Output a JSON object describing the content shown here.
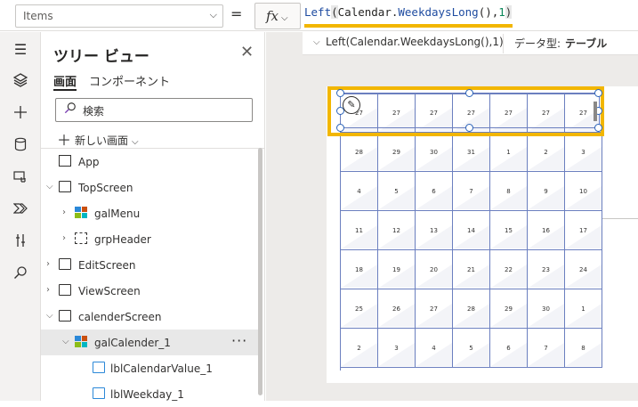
{
  "formula_bar": {
    "property": "Items",
    "equals": "=",
    "fx_label": "fx",
    "formula": {
      "fn1": "Left",
      "open1": "(",
      "obj": "Calendar.",
      "fn2": "WeekdaysLong",
      "mid": "(),",
      "num": "1",
      "close1": ")"
    }
  },
  "formula_hint": {
    "formula": "Left(Calendar.WeekdaysLong(),1)",
    "type_label": "データ型:",
    "type_value": "テーブル"
  },
  "tree": {
    "title": "ツリー ビュー",
    "tabs": [
      "画面",
      "コンポーネント"
    ],
    "search_placeholder": "検索",
    "new_screen": "新しい画面",
    "items": [
      {
        "label": "App"
      },
      {
        "label": "TopScreen"
      },
      {
        "label": "galMenu"
      },
      {
        "label": "grpHeader"
      },
      {
        "label": "EditScreen"
      },
      {
        "label": "ViewScreen"
      },
      {
        "label": "calenderScreen"
      },
      {
        "label": "galCalender_1"
      },
      {
        "label": "lblCalendarValue_1"
      },
      {
        "label": "lblWeekday_1"
      }
    ]
  },
  "rail_icons": [
    "hamburger-icon",
    "layers-icon",
    "add-icon",
    "database-icon",
    "media-icon",
    "power-automate-icon",
    "advanced-tools-icon",
    "search-icon"
  ],
  "colors": {
    "highlight": "#f2b600",
    "grid_line": "#6b7fbf",
    "selection_handle": "#2b63b8"
  },
  "calendar": [
    [
      "27",
      "27",
      "27",
      "27",
      "27",
      "27",
      "27"
    ],
    [
      "28",
      "29",
      "30",
      "31",
      "1",
      "2",
      "3"
    ],
    [
      "4",
      "5",
      "6",
      "7",
      "8",
      "9",
      "10"
    ],
    [
      "11",
      "12",
      "13",
      "14",
      "15",
      "16",
      "17"
    ],
    [
      "18",
      "19",
      "20",
      "21",
      "22",
      "23",
      "24"
    ],
    [
      "25",
      "26",
      "27",
      "28",
      "29",
      "30",
      "1"
    ],
    [
      "2",
      "3",
      "4",
      "5",
      "6",
      "7",
      "8"
    ]
  ]
}
